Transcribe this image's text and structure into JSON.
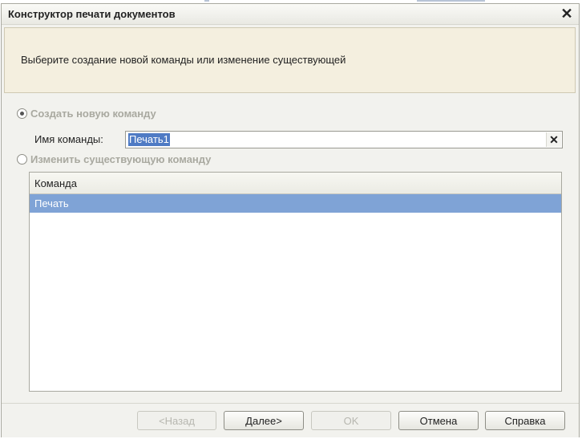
{
  "dialog": {
    "title": "Конструктор печати документов",
    "close_icon": "close-icon"
  },
  "info": {
    "text": "Выберите создание новой команды или изменение существующей"
  },
  "options": {
    "create_label": "Создать новую команду",
    "create_checked": true,
    "change_label": "Изменить существующую команду",
    "change_checked": false
  },
  "command_name": {
    "label": "Имя команды:",
    "value": "Печать1",
    "clear_icon": "clear-icon"
  },
  "commands_table": {
    "header": "Команда",
    "rows": [
      "Печать"
    ],
    "selected_row_color": "#7fa3d6"
  },
  "buttons": {
    "back": "<Назад",
    "next": "Далее>",
    "ok": "OK",
    "cancel": "Отмена",
    "help": "Справка"
  },
  "colors": {
    "selection": "#4f7bc4",
    "info_panel": "#f4efdf"
  }
}
